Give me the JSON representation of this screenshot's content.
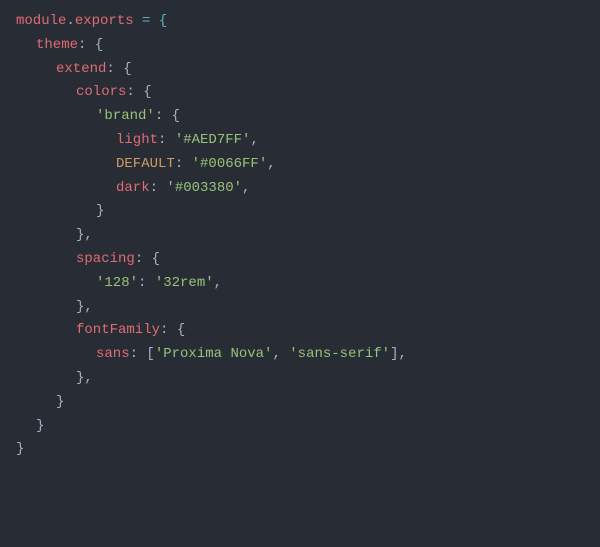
{
  "line1": {
    "module": "module",
    "dot": ".",
    "exports": "exports",
    "assign": " = {"
  },
  "line2": {
    "theme": "theme",
    "colon": ": {"
  },
  "line3": {
    "extend": "extend",
    "colon": ": {"
  },
  "line4": {
    "colors": "colors",
    "colon": ": {"
  },
  "line5": {
    "key": "'brand'",
    "colon": ": {"
  },
  "line6": {
    "prop": "light",
    "colon": ": ",
    "val": "'#AED7FF'",
    "comma": ","
  },
  "line7": {
    "prop": "DEFAULT",
    "colon": ": ",
    "val": "'#0066FF'",
    "comma": ","
  },
  "line8": {
    "prop": "dark",
    "colon": ": ",
    "val": "'#003380'",
    "comma": ","
  },
  "line9": {
    "brace": "}"
  },
  "line10": {
    "brace": "},"
  },
  "line11": {
    "spacing": "spacing",
    "colon": ": {"
  },
  "line12": {
    "key": "'128'",
    "colon": ": ",
    "val": "'32rem'",
    "comma": ","
  },
  "line13": {
    "brace": "},"
  },
  "line14": {
    "fontFamily": "fontFamily",
    "colon": ": {"
  },
  "line15": {
    "prop": "sans",
    "colon": ": [",
    "v1": "'Proxima Nova'",
    "sep": ", ",
    "v2": "'sans-serif'",
    "end": "],"
  },
  "line16": {
    "brace": "},"
  },
  "line17": {
    "brace": "}"
  },
  "line18": {
    "brace": "}"
  },
  "line19": {
    "brace": "}"
  }
}
